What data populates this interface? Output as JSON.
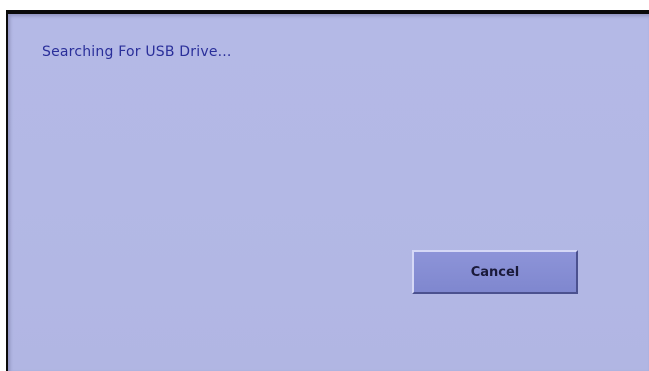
{
  "dialog": {
    "status_text": "Searching For USB Drive...",
    "cancel_label": "Cancel"
  },
  "colors": {
    "background": "#b3b8e5",
    "status_text": "#2a2f9a",
    "button_face": "#858ccf",
    "button_text": "#1a1a3a"
  }
}
